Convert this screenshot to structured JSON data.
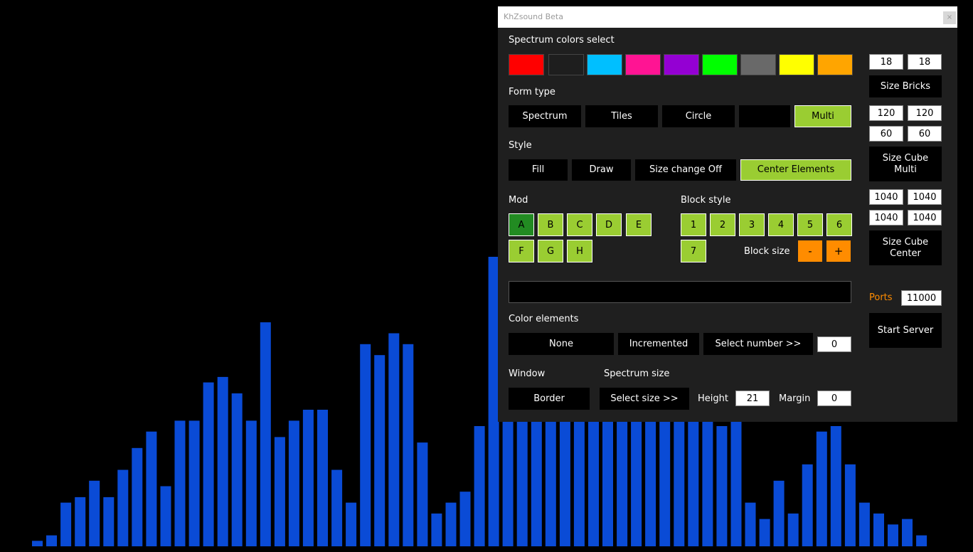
{
  "spectrum": {
    "bar_color": "#0a4bd6",
    "levels": [
      0.01,
      0.02,
      0.08,
      0.09,
      0.12,
      0.09,
      0.14,
      0.18,
      0.21,
      0.11,
      0.23,
      0.23,
      0.3,
      0.31,
      0.28,
      0.23,
      0.41,
      0.2,
      0.23,
      0.25,
      0.25,
      0.14,
      0.08,
      0.37,
      0.35,
      0.39,
      0.37,
      0.19,
      0.06,
      0.08,
      0.1,
      0.22,
      0.53,
      0.26,
      0.28,
      0.46,
      0.31,
      0.32,
      0.41,
      0.27,
      0.31,
      0.32,
      0.3,
      0.28,
      0.26,
      0.29,
      0.26,
      0.32,
      0.22,
      0.28,
      0.08,
      0.05,
      0.12,
      0.06,
      0.15,
      0.21,
      0.22,
      0.15,
      0.08,
      0.06,
      0.04,
      0.05,
      0.02
    ]
  },
  "window": {
    "title": "KhZsound Beta",
    "close": "×"
  },
  "colors_label": "Spectrum colors select",
  "swatches": [
    "#ff0000",
    "#1e1e1e",
    "#00bfff",
    "#ff1493",
    "#9400d3",
    "#00ff00",
    "#696969",
    "#ffff00",
    "#ffa500"
  ],
  "form_type": {
    "label": "Form type",
    "spectrum": "Spectrum",
    "tiles": "Tiles",
    "circle": "Circle",
    "blank": "",
    "multi": "Multi"
  },
  "style": {
    "label": "Style",
    "fill": "Fill",
    "draw": "Draw",
    "size_change": "Size change Off",
    "center": "Center Elements"
  },
  "mod": {
    "label": "Mod",
    "items": [
      "A",
      "B",
      "C",
      "D",
      "E",
      "F",
      "G",
      "H"
    ]
  },
  "block_style": {
    "label": "Block style",
    "items": [
      "1",
      "2",
      "3",
      "4",
      "5",
      "6",
      "7"
    ],
    "size_label": "Block size",
    "minus": "-",
    "plus": "+"
  },
  "color_elements": {
    "label": "Color elements",
    "none": "None",
    "incremented": "Incremented",
    "select_number": "Select number >>",
    "number": "0"
  },
  "window_section": {
    "label": "Window",
    "border": "Border"
  },
  "spectrum_size": {
    "label": "Spectrum size",
    "select_size": "Select size >>",
    "height_label": "Height",
    "height": "21",
    "margin_label": "Margin",
    "margin": "0"
  },
  "bricks": {
    "w": "18",
    "h": "18",
    "button": "Size Bricks"
  },
  "cube_multi": {
    "v1": "120",
    "v2": "120",
    "v3": "60",
    "v4": "60",
    "button": "Size Cube Multi"
  },
  "cube_center": {
    "v1": "1040",
    "v2": "1040",
    "v3": "1040",
    "v4": "1040",
    "button": "Size Cube Center"
  },
  "ports": {
    "label": "Ports",
    "label_color": "#ff8c00",
    "value": "11000",
    "start": "Start Server"
  }
}
